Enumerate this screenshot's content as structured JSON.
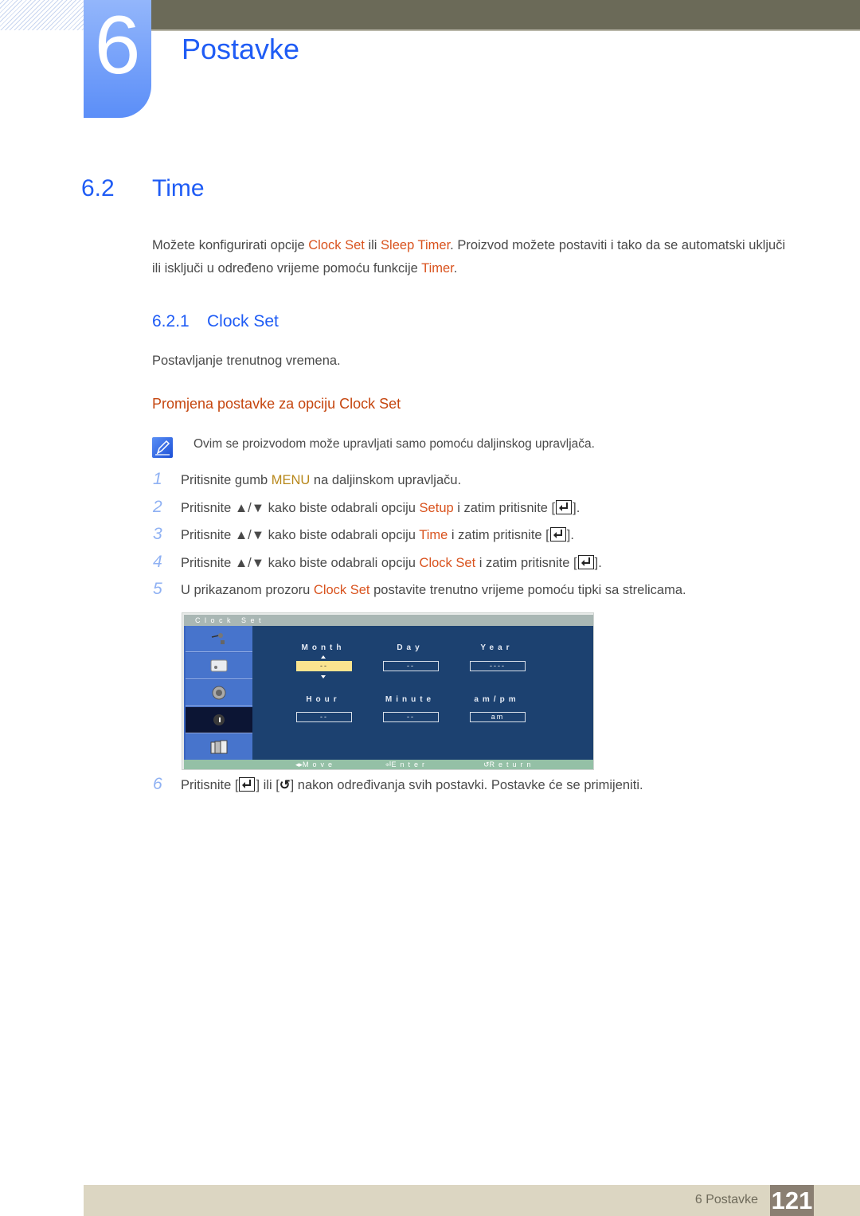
{
  "chapter": {
    "number": "6",
    "title": "Postavke"
  },
  "section": {
    "number": "6.2",
    "title": "Time"
  },
  "intro": {
    "parts": [
      {
        "text": "Možete konfigurirati opcije ",
        "hl": false
      },
      {
        "text": "Clock Set",
        "hl": true
      },
      {
        "text": " ili ",
        "hl": false
      },
      {
        "text": "Sleep Timer",
        "hl": true
      },
      {
        "text": ". Proizvod možete postaviti i tako da se automatski uključi ili isključi u određeno vrijeme pomoću funkcije ",
        "hl": false
      },
      {
        "text": "Timer",
        "hl": true
      },
      {
        "text": ".",
        "hl": false
      }
    ]
  },
  "subsection": {
    "number": "6.2.1",
    "title": "Clock Set",
    "description": "Postavljanje trenutnog vremena."
  },
  "procedure_heading": "Promjena postavke za opciju Clock Set",
  "note": {
    "icon": "note-pencil-icon",
    "text": "Ovim se proizvodom može upravljati samo pomoću daljinskog upravljača."
  },
  "steps": [
    {
      "n": "1",
      "a": "Pritisnite gumb ",
      "hl": "MENU",
      "b": " na daljinskom upravljaču.",
      "enter": false
    },
    {
      "n": "2",
      "a": "Pritisnite ▲/▼ kako biste odabrali opciju ",
      "hl": "Setup",
      "b": " i zatim pritisnite [",
      "enter": true,
      "c": "]."
    },
    {
      "n": "3",
      "a": "Pritisnite ▲/▼ kako biste odabrali opciju ",
      "hl": "Time",
      "b": " i zatim pritisnite [",
      "enter": true,
      "c": "]."
    },
    {
      "n": "4",
      "a": "Pritisnite ▲/▼ kako biste odabrali opciju ",
      "hl": "Clock Set",
      "b": " i zatim pritisnite [",
      "enter": true,
      "c": "]."
    },
    {
      "n": "5",
      "a": "U prikazanom prozoru ",
      "hl": "Clock Set",
      "b": " postavite trenutno vrijeme pomoću tipki sa strelicama.",
      "enter": false
    }
  ],
  "step6": {
    "n": "6",
    "a": "Pritisnite [",
    "b": "] ili [",
    "return_glyph": "↺",
    "c": "] nakon određivanja svih postavki. Postavke će se primijeniti."
  },
  "osd": {
    "title": "Clock Set",
    "side_icons": [
      "plug-icon",
      "picture-icon",
      "speaker-icon",
      "gear-icon",
      "multi-screen-icon"
    ],
    "selected_index": 3,
    "labels": {
      "month": "Month",
      "day": "Day",
      "year": "Year",
      "hour": "Hour",
      "minute": "Minute",
      "ampm": "am/pm"
    },
    "values": {
      "month": "--",
      "day": "--",
      "year": "----",
      "hour": "--",
      "minute": "--",
      "ampm": "am"
    },
    "footer": {
      "move": "Move",
      "enter": "Enter",
      "return": "Return"
    }
  },
  "footer": {
    "label": "6 Postavke",
    "page": "121"
  }
}
